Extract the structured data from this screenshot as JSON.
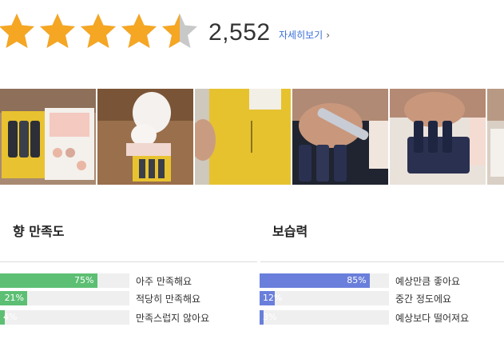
{
  "rating": {
    "value": 4.5,
    "max": 5,
    "count": "2,552",
    "detail_link": "자세히보기",
    "star_color": "#f5a623",
    "star_empty_color": "#c8c8c8"
  },
  "gallery": {
    "photos": [
      {
        "name": "hand-cream-gift-box"
      },
      {
        "name": "cat-with-gift-box"
      },
      {
        "name": "yellow-box-in-hand"
      },
      {
        "name": "hand-holding-tube"
      },
      {
        "name": "tubes-in-tray"
      },
      {
        "name": "partial-photo"
      }
    ]
  },
  "scent": {
    "title": "향 만족도",
    "color": "#5cbf73",
    "options": [
      {
        "label": "아주 만족해요",
        "percent": 75,
        "percent_text": "75%"
      },
      {
        "label": "적당히 만족해요",
        "percent": 21,
        "percent_text": "21%"
      },
      {
        "label": "만족스럽지 않아요",
        "percent": 4,
        "percent_text": "4%"
      }
    ]
  },
  "moisture": {
    "title": "보습력",
    "color": "#6a7fdb",
    "options": [
      {
        "label": "예상만큼 좋아요",
        "percent": 85,
        "percent_text": "85%"
      },
      {
        "label": "중간 정도에요",
        "percent": 12,
        "percent_text": "12%"
      },
      {
        "label": "예상보다 떨어져요",
        "percent": 3,
        "percent_text": "3%"
      }
    ]
  }
}
